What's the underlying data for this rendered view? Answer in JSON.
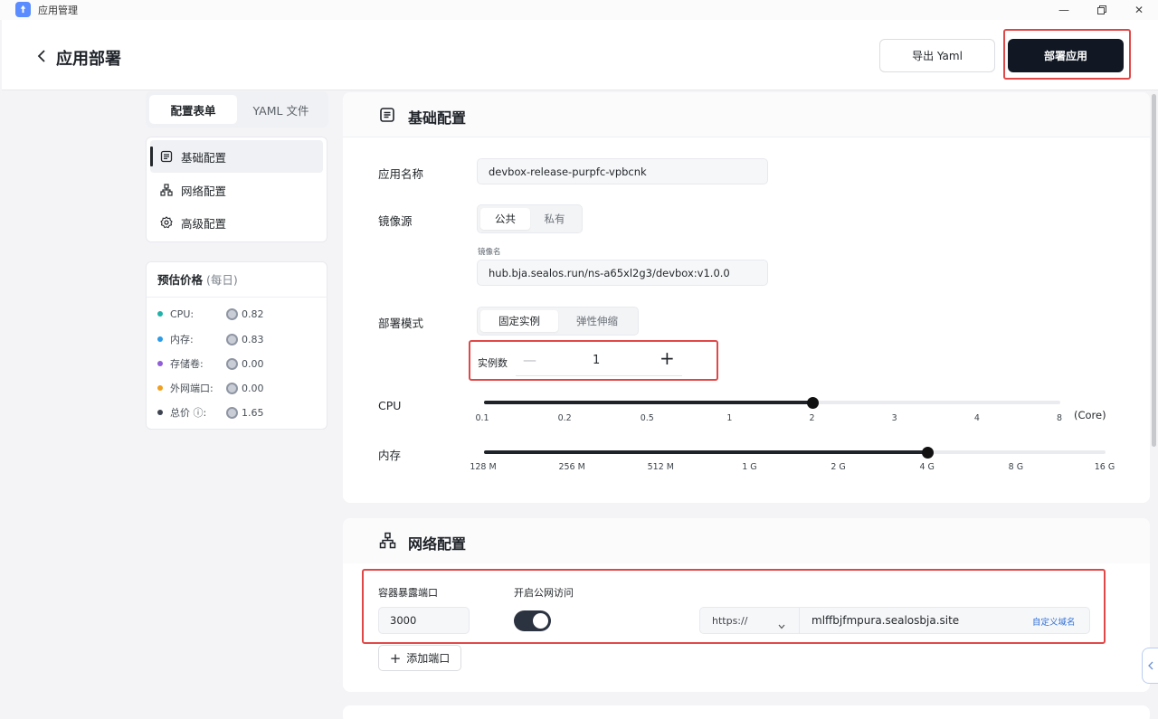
{
  "window": {
    "title": "应用管理"
  },
  "header": {
    "title": "应用部署",
    "export_label": "导出 Yaml",
    "deploy_label": "部署应用"
  },
  "tabs": {
    "form": "配置表单",
    "yaml": "YAML 文件"
  },
  "nav": {
    "items": [
      "基础配置",
      "网络配置",
      "高级配置"
    ]
  },
  "price": {
    "title": "预估价格",
    "period": "(每日)",
    "rows": [
      {
        "label": "CPU:",
        "value": "0.82",
        "color": "#20b2aa"
      },
      {
        "label": "内存:",
        "value": "0.83",
        "color": "#2c9be8"
      },
      {
        "label": "存储卷:",
        "value": "0.00",
        "color": "#8f5ed8"
      },
      {
        "label": "外网端口:",
        "value": "0.00",
        "color": "#f0a020"
      },
      {
        "label": "总价 ⓘ:",
        "value": "1.65",
        "color": "#3d4450"
      }
    ]
  },
  "basic": {
    "title": "基础配置",
    "app_name_label": "应用名称",
    "app_name_value": "devbox-release-purpfc-vpbcnk",
    "image_source_label": "镜像源",
    "image_source_options": [
      "公共",
      "私有"
    ],
    "image_name_label": "镜像名",
    "image_name_value": "hub.bja.sealos.run/ns-a65xl2g3/devbox:v1.0.0",
    "deploy_mode_label": "部署模式",
    "deploy_mode_options": [
      "固定实例",
      "弹性伸缩"
    ],
    "instances_label": "实例数",
    "instances_value": "1",
    "cpu_label": "CPU",
    "cpu_ticks": [
      "0.1",
      "0.2",
      "0.5",
      "1",
      "2",
      "3",
      "4",
      "8"
    ],
    "cpu_unit": "(Core)",
    "cpu_selected": "2",
    "mem_label": "内存",
    "mem_ticks": [
      "128 M",
      "256 M",
      "512 M",
      "1 G",
      "2 G",
      "4 G",
      "8 G",
      "16 G"
    ],
    "mem_selected": "4 G"
  },
  "network": {
    "title": "网络配置",
    "port_label": "容器暴露端口",
    "port_value": "3000",
    "public_label": "开启公网访问",
    "public_enabled": true,
    "protocol": "https://",
    "domain": "mlffbjfmpura.sealosbja.site",
    "custom_domain_label": "自定义域名",
    "add_port_label": "添加端口"
  }
}
